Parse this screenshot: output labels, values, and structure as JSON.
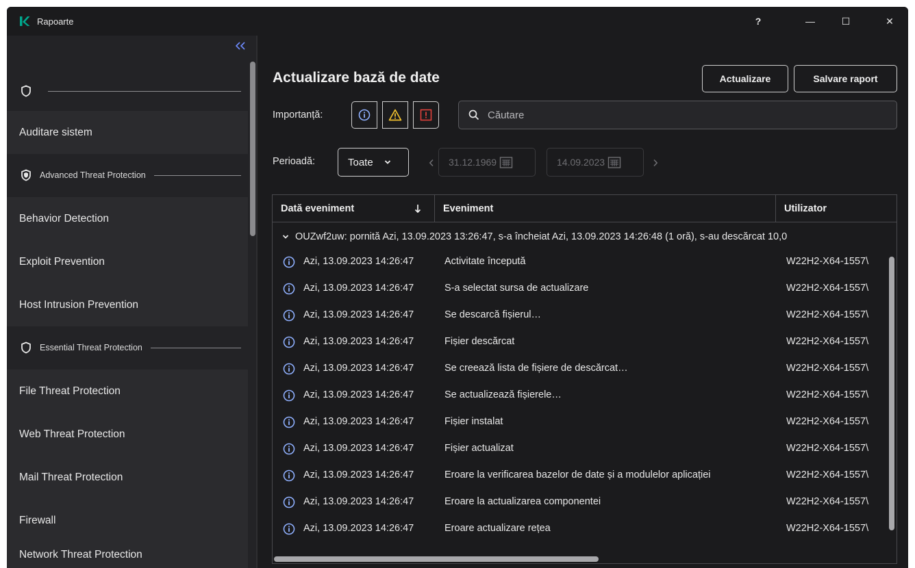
{
  "window": {
    "title": "Rapoarte",
    "help_label": "?",
    "minimize_label": "—",
    "maximize_label": "☐",
    "close_label": "✕"
  },
  "sidebar": {
    "collapse_icon": "double-chevron-left-icon",
    "groups": {
      "top": {
        "label": "",
        "icon": "shield-icon"
      },
      "atp": {
        "label": "Advanced Threat Protection",
        "icon": "shield-check-icon"
      },
      "etp": {
        "label": "Essential Threat Protection",
        "icon": "shield-icon"
      }
    },
    "items": [
      {
        "label": "Auditare sistem"
      },
      {
        "label": "Behavior Detection"
      },
      {
        "label": "Exploit Prevention"
      },
      {
        "label": "Host Intrusion Prevention"
      },
      {
        "label": "File Threat Protection"
      },
      {
        "label": "Web Threat Protection"
      },
      {
        "label": "Mail Threat Protection"
      },
      {
        "label": "Firewall"
      },
      {
        "label": "Network Threat Protection"
      }
    ]
  },
  "main": {
    "title": "Actualizare bază de date",
    "refresh_label": "Actualizare",
    "save_label": "Salvare raport",
    "importance_label": "Importanță:",
    "severity": [
      "info-icon",
      "warning-icon",
      "critical-icon"
    ],
    "search_placeholder": "Căutare",
    "period_label": "Perioadă:",
    "period_value": "Toate",
    "date_from": "31.12.1969",
    "date_to": "14.09.2023"
  },
  "table": {
    "columns": [
      "Dată eveniment",
      "Eveniment",
      "Utilizator"
    ],
    "sort_icon": "arrow-down-icon",
    "group_row": "OUZwf2uw: pornită Azi, 13.09.2023 13:26:47, s-a încheiat Azi, 13.09.2023 14:26:48 (1 oră), s-au descărcat 10,0",
    "rows": [
      {
        "date": "Azi, 13.09.2023 14:26:47",
        "event": "Activitate începută",
        "user": "W22H2-X64-1557\\"
      },
      {
        "date": "Azi, 13.09.2023 14:26:47",
        "event": "S-a selectat sursa de actualizare",
        "user": "W22H2-X64-1557\\"
      },
      {
        "date": "Azi, 13.09.2023 14:26:47",
        "event": "Se descarcă fișierul…",
        "user": "W22H2-X64-1557\\"
      },
      {
        "date": "Azi, 13.09.2023 14:26:47",
        "event": "Fișier descărcat",
        "user": "W22H2-X64-1557\\"
      },
      {
        "date": "Azi, 13.09.2023 14:26:47",
        "event": "Se creează lista de fișiere de descărcat…",
        "user": "W22H2-X64-1557\\"
      },
      {
        "date": "Azi, 13.09.2023 14:26:47",
        "event": "Se actualizează fișierele…",
        "user": "W22H2-X64-1557\\"
      },
      {
        "date": "Azi, 13.09.2023 14:26:47",
        "event": "Fișier instalat",
        "user": "W22H2-X64-1557\\"
      },
      {
        "date": "Azi, 13.09.2023 14:26:47",
        "event": "Fișier actualizat",
        "user": "W22H2-X64-1557\\"
      },
      {
        "date": "Azi, 13.09.2023 14:26:47",
        "event": "Eroare la verificarea bazelor de date și a modulelor aplicației",
        "user": "W22H2-X64-1557\\"
      },
      {
        "date": "Azi, 13.09.2023 14:26:47",
        "event": "Eroare la actualizarea componentei",
        "user": "W22H2-X64-1557\\"
      },
      {
        "date": "Azi, 13.09.2023 14:26:47",
        "event": "Eroare actualizare rețea",
        "user": "W22H2-X64-1557\\"
      }
    ]
  },
  "colors": {
    "accent": "#6e8cff",
    "info": "#8fb0ff",
    "warning": "#f2c12e",
    "critical": "#e0413b",
    "logo": "#00a88e"
  }
}
